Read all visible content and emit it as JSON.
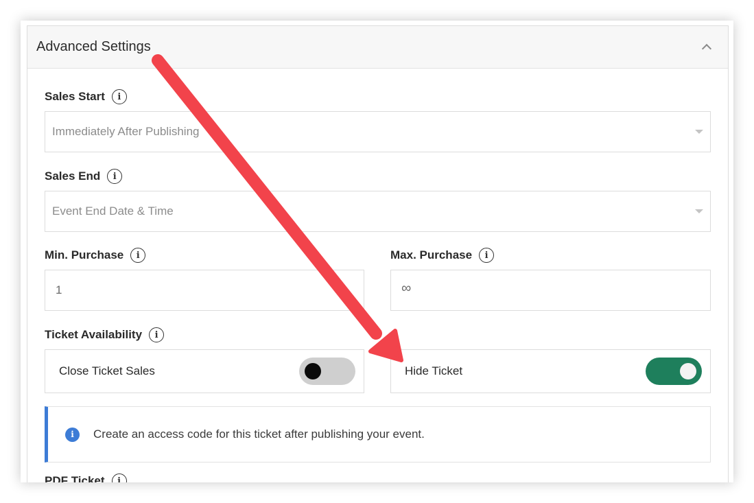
{
  "panel": {
    "title": "Advanced Settings"
  },
  "sales_start": {
    "label": "Sales Start",
    "value": "Immediately After Publishing"
  },
  "sales_end": {
    "label": "Sales End",
    "value": "Event End Date & Time"
  },
  "min_purchase": {
    "label": "Min. Purchase",
    "value": "1"
  },
  "max_purchase": {
    "label": "Max. Purchase",
    "value": "∞"
  },
  "ticket_availability": {
    "label": "Ticket Availability",
    "close_sales_label": "Close Ticket Sales",
    "close_sales_on": false,
    "hide_ticket_label": "Hide Ticket",
    "hide_ticket_on": true
  },
  "notice": {
    "text": "Create an access code for this ticket after publishing your event."
  },
  "pdf_ticket": {
    "label": "PDF Ticket"
  },
  "colors": {
    "toggle_on": "#1e7f5c",
    "info_accent": "#3d7cd6",
    "annotation_arrow": "#f2434b"
  },
  "icons": {
    "collapse": "chevron-up-icon",
    "info": "info-icon"
  }
}
